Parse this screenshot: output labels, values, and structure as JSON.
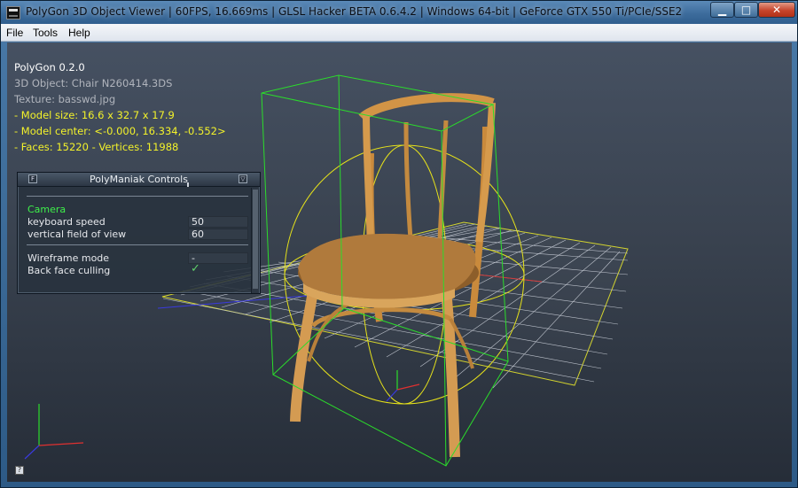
{
  "window": {
    "title": "PolyGon 3D Object Viewer | 60FPS, 16.669ms | GLSL Hacker BETA 0.6.4.2 | Windows 64-bit | GeForce GTX 550 Ti/PCIe/SSE2",
    "minimize_glyph": "▁",
    "maximize_glyph": "□",
    "close_glyph": "✕"
  },
  "menu": {
    "file": "File",
    "tools": "Tools",
    "help": "Help"
  },
  "info": {
    "app_version": "PolyGon 0.2.0",
    "object": "3D Object: Chair N260414.3DS",
    "texture": "Texture: basswd.jpg",
    "model_size": "- Model size:  16.6 x 32.7 x 17.9",
    "model_center": "- Model center:  <-0.000, 16.334, -0.552>",
    "faces_vertices": "- Faces: 15220 - Vertices: 11988"
  },
  "panel": {
    "title": "PolyManiak Controls",
    "left_button": "F",
    "right_button": "▽",
    "section_camera": "Camera",
    "keyboard_speed_label": "keyboard speed",
    "keyboard_speed_value": "50",
    "fov_label": "vertical field of view",
    "fov_value": "60",
    "wireframe_label": "Wireframe mode",
    "wireframe_value": "-",
    "backface_label": "Back face culling",
    "backface_check": "✓"
  },
  "help_icon": "?",
  "colors": {
    "info_white": "#ffffff",
    "info_grey": "#b0b4bc",
    "info_yellow": "#f3f22a",
    "camera_green": "#3ef04a",
    "bbox_green": "#2bdc2b",
    "bsphere_yellow": "#e6e21a",
    "chair_wood": "#c98a3c"
  },
  "icons": {
    "app": "app-logo-icon",
    "help": "help-icon",
    "axes": "axis-gizmo-icon"
  }
}
